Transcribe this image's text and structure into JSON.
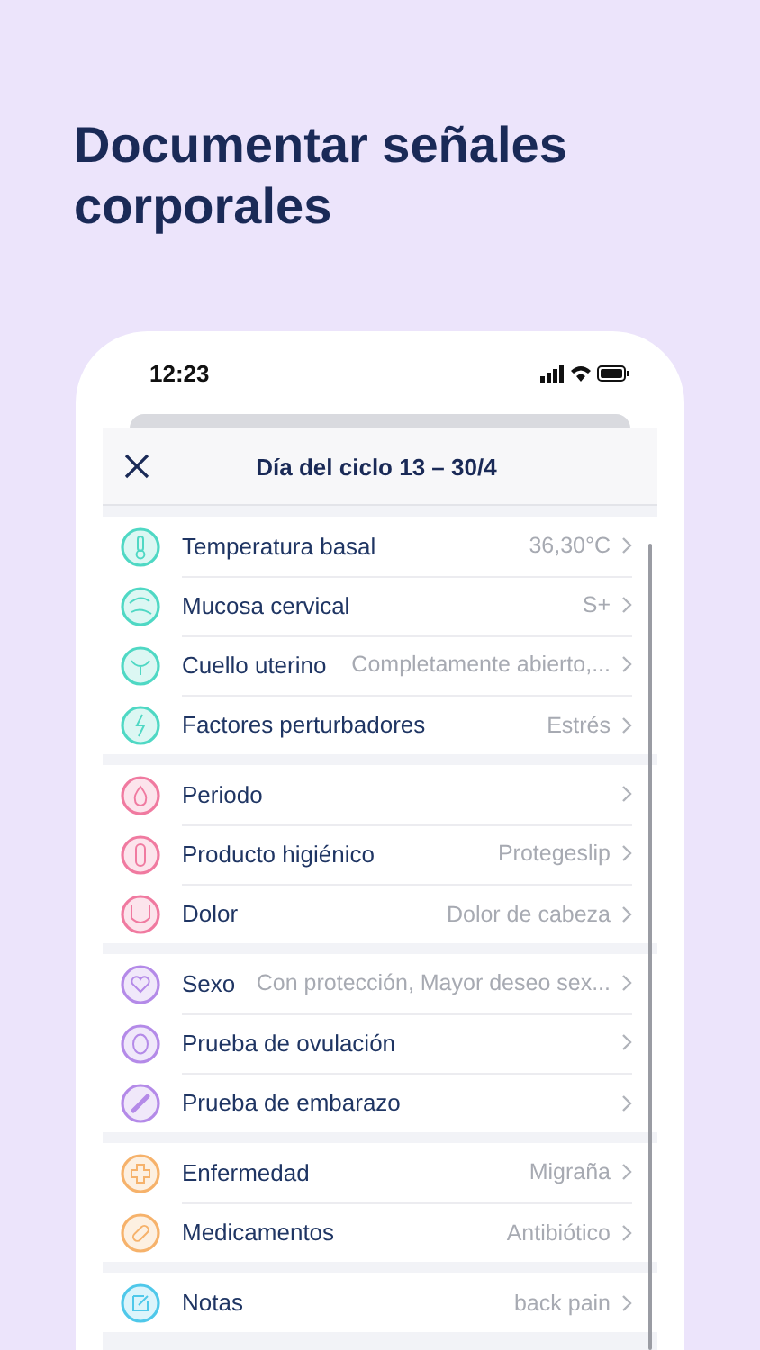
{
  "headline": "Documentar señales corporales",
  "status_bar": {
    "time": "12:23"
  },
  "sheet": {
    "title": "Día del ciclo 13 – 30/4"
  },
  "groups": [
    {
      "color": "#4fd8c4",
      "rows": [
        {
          "label": "Temperatura basal",
          "value": "36,30°C"
        },
        {
          "label": "Mucosa cervical",
          "value": "S+"
        },
        {
          "label": "Cuello uterino",
          "value": "Completamente abierto,..."
        },
        {
          "label": "Factores perturbadores",
          "value": "Estrés"
        }
      ]
    },
    {
      "color": "#f07aa0",
      "rows": [
        {
          "label": "Periodo"
        },
        {
          "label": "Producto higiénico",
          "value": "Protegeslip"
        },
        {
          "label": "Dolor",
          "value": "Dolor de cabeza"
        }
      ]
    },
    {
      "color": "#b48ae8",
      "rows": [
        {
          "label": "Sexo",
          "value": "Con protección, Mayor deseo sex..."
        },
        {
          "label": "Prueba de ovulación"
        },
        {
          "label": "Prueba de embarazo"
        }
      ]
    },
    {
      "color": "#f6b26b",
      "rows": [
        {
          "label": "Enfermedad",
          "value": "Migraña"
        },
        {
          "label": "Medicamentos",
          "value": "Antibiótico"
        }
      ]
    },
    {
      "color": "#4fc8ea",
      "rows": [
        {
          "label": "Notas",
          "value": "back pain"
        }
      ]
    }
  ]
}
